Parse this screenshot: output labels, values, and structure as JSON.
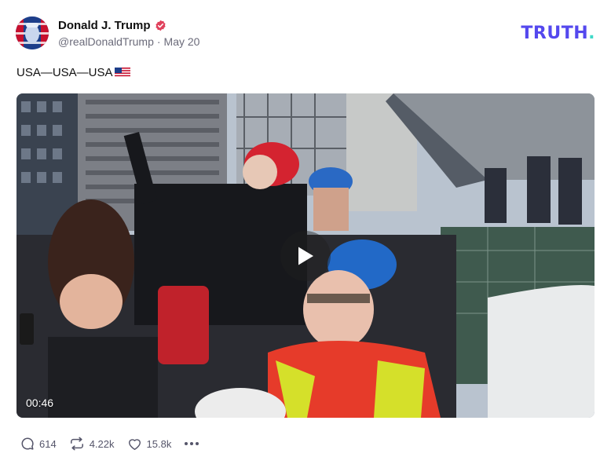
{
  "post": {
    "author": {
      "display_name": "Donald J. Trump",
      "handle": "@realDonaldTrump",
      "date": "May 20",
      "verified": true
    },
    "text": "USA—USA—USA",
    "text_emoji": "us-flag",
    "video": {
      "duration": "00:46"
    },
    "actions": {
      "replies": "614",
      "retruths": "4.22k",
      "likes": "15.8k"
    }
  },
  "brand": {
    "text": "TRUTH",
    "dot": ".",
    "color": "#5448ee",
    "dot_color": "#3fd9c8"
  },
  "colors": {
    "verified_badge": "#e0415c",
    "meta_text": "#6b6b7a"
  }
}
